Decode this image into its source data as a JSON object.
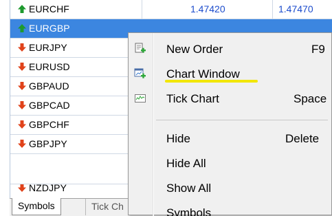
{
  "market_watch": {
    "rows": [
      {
        "symbol": "EURCHF",
        "direction": "up",
        "bid": "1.47420",
        "ask": "1.47470"
      },
      {
        "symbol": "EURGBP",
        "direction": "up",
        "bid": "",
        "ask": ""
      },
      {
        "symbol": "EURJPY",
        "direction": "down",
        "bid": "",
        "ask": ""
      },
      {
        "symbol": "EURUSD",
        "direction": "down",
        "bid": "",
        "ask": ""
      },
      {
        "symbol": "GBPAUD",
        "direction": "down",
        "bid": "",
        "ask": ""
      },
      {
        "symbol": "GBPCAD",
        "direction": "down",
        "bid": "",
        "ask": ""
      },
      {
        "symbol": "GBPCHF",
        "direction": "down",
        "bid": "",
        "ask": ""
      },
      {
        "symbol": "GBPJPY",
        "direction": "down",
        "bid": "",
        "ask": ""
      },
      {
        "symbol": "NZDJPY",
        "direction": "down",
        "bid": "",
        "ask": ""
      }
    ],
    "selected_symbol": "EURGBP"
  },
  "tabs": [
    {
      "label": "Symbols",
      "active": true
    },
    {
      "label": "Tick Ch",
      "active": false
    }
  ],
  "context_menu": {
    "items": [
      {
        "label": "New Order",
        "shortcut": "F9",
        "icon": "new-order-icon"
      },
      {
        "label": "Chart Window",
        "shortcut": "",
        "icon": "chart-window-icon",
        "highlighted_by_underline": true
      },
      {
        "label": "Tick Chart",
        "shortcut": "Space",
        "icon": "tick-chart-icon"
      },
      {
        "label": "Hide",
        "shortcut": "Delete",
        "icon": ""
      },
      {
        "label": "Hide All",
        "shortcut": "",
        "icon": ""
      },
      {
        "label": "Show All",
        "shortcut": "",
        "icon": ""
      },
      {
        "label": "Symbols",
        "shortcut": "",
        "icon": ""
      }
    ]
  },
  "colors": {
    "up_arrow": "#1e9a2e",
    "down_arrow": "#e0421a",
    "selection": "#3c86e0",
    "price_text": "#1c4ccc",
    "annotation_underline": "#f2e600"
  }
}
